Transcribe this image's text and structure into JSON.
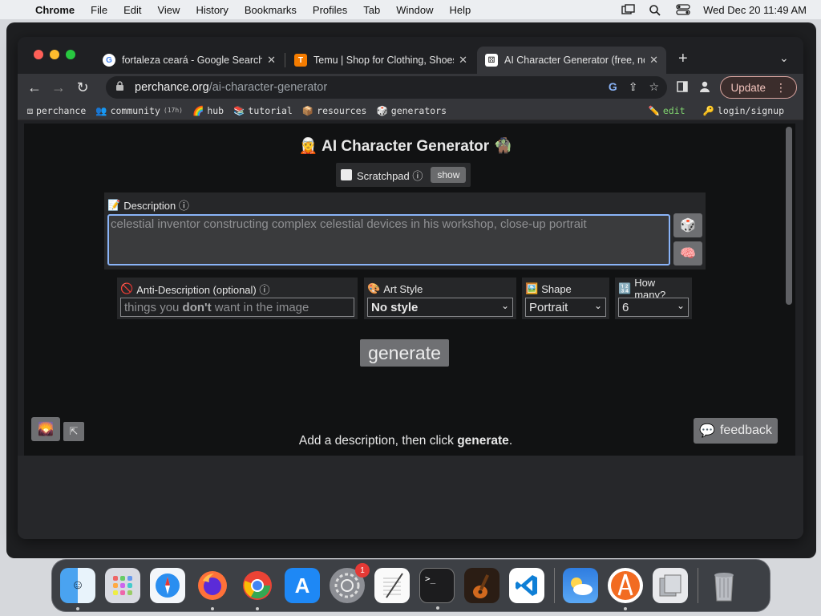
{
  "menubar": {
    "app_name": "Chrome",
    "items": [
      "File",
      "Edit",
      "View",
      "History",
      "Bookmarks",
      "Profiles",
      "Tab",
      "Window",
      "Help"
    ],
    "clock": "Wed Dec 20  11:49 AM"
  },
  "tabs": [
    {
      "title": "fortaleza ceará - Google Search",
      "favicon": "google-icon",
      "active": false
    },
    {
      "title": "Temu | Shop for Clothing, Shoes",
      "favicon": "temu-icon",
      "active": false
    },
    {
      "title": "AI Character Generator (free, no",
      "favicon": "perchance-icon",
      "active": true
    }
  ],
  "toolbar": {
    "url_domain": "perchance.org",
    "url_path": "/ai-character-generator",
    "update_label": "Update"
  },
  "bookmarks": {
    "items": [
      {
        "label": "perchance",
        "icon": "dice-icon"
      },
      {
        "label": "community",
        "badge": "(17h)",
        "icon": "people-icon"
      },
      {
        "label": "hub",
        "icon": "rainbow-icon"
      },
      {
        "label": "tutorial",
        "icon": "books-icon"
      },
      {
        "label": "resources",
        "icon": "box-icon"
      },
      {
        "label": "generators",
        "icon": "dice-icon"
      }
    ],
    "edit": "edit",
    "login": "login/signup"
  },
  "page": {
    "title": "🧝 AI Character Generator 🧌",
    "scratchpad_label": "Scratchpad ⓘ",
    "scratchpad_show": "show",
    "description_label": "Description ⓘ",
    "description_value": "celestial inventor constructing complex celestial devices in his workshop, close-up portrait",
    "anti_label": "Anti-Description (optional) ⓘ",
    "anti_placeholder_a": "things you ",
    "anti_placeholder_b": "don't",
    "anti_placeholder_c": " want in the image",
    "art_style_label": "Art Style",
    "art_style_value": "No style",
    "shape_label": "Shape",
    "shape_value": "Portrait",
    "count_label": "How many?",
    "count_value": "6",
    "generate_label": "generate",
    "hint_a": "Add a description, then click ",
    "hint_b": "generate",
    "hint_c": ".",
    "feedback_label": "feedback"
  },
  "dock": {
    "apps": [
      "Finder",
      "Launchpad",
      "Safari",
      "Firefox",
      "Chrome",
      "App Store",
      "System Settings",
      "TextEdit",
      "Terminal",
      "GarageBand",
      "VS Code",
      "Weather",
      "Instruments",
      "Preview",
      "Trash"
    ],
    "settings_badge": "1"
  }
}
